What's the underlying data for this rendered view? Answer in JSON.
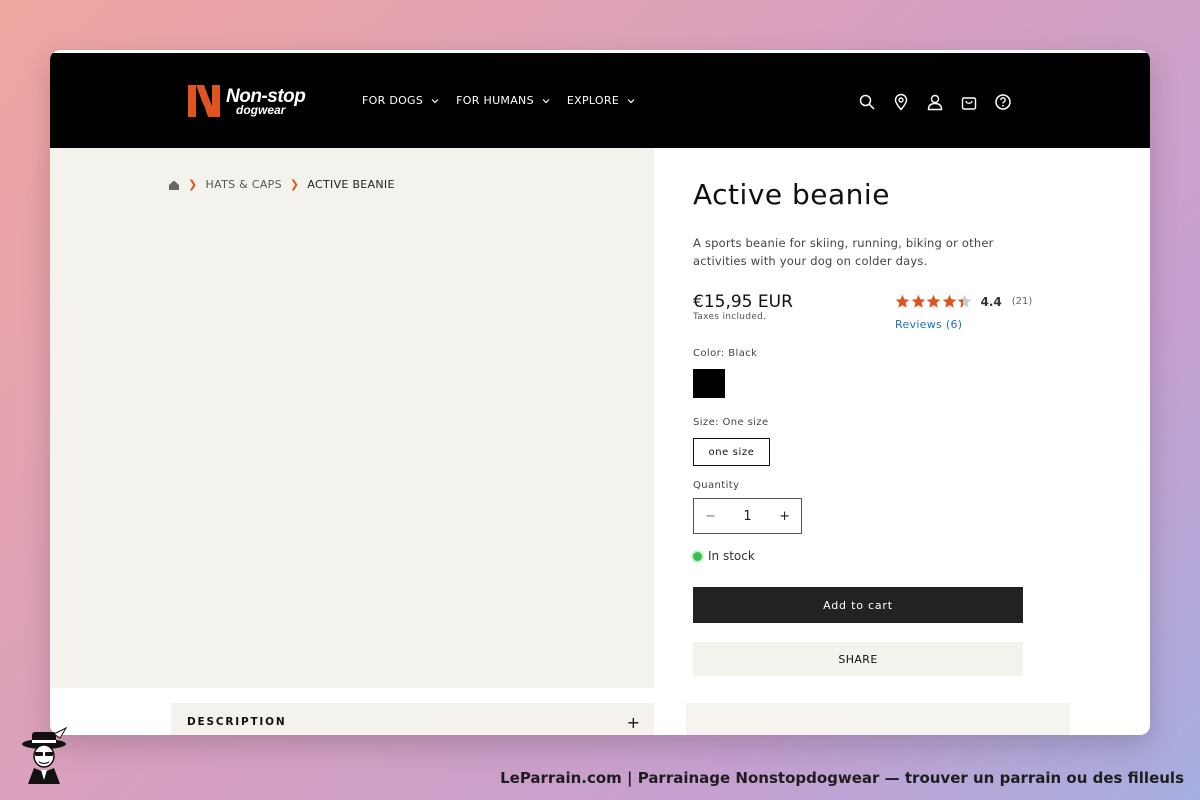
{
  "header": {
    "logo_main": "Non-stop",
    "logo_sub": "dogwear",
    "nav": [
      {
        "label": "FOR DOGS"
      },
      {
        "label": "FOR HUMANS"
      },
      {
        "label": "EXPLORE"
      }
    ]
  },
  "breadcrumb": {
    "items": [
      "HATS & CAPS",
      "ACTIVE BEANIE"
    ]
  },
  "product": {
    "title": "Active beanie",
    "description": "A sports beanie for skiing, running, biking or other activities with your dog on colder days.",
    "price": "€15,95 EUR",
    "tax_note": "Taxes included.",
    "rating": {
      "value": 4.4,
      "value_text": "4.4",
      "count_text": "(21)",
      "reviews_link": "Reviews (6)",
      "star_color": "#e0541f"
    },
    "color_label": "Color: Black",
    "color_swatch": "#000000",
    "size_label": "Size: One size",
    "size_option": "one size",
    "quantity_label": "Quantity",
    "quantity_minus": "−",
    "quantity_value": "1",
    "quantity_plus": "+",
    "stock_text": "In stock",
    "add_to_cart": "Add to cart",
    "share": "SHARE"
  },
  "description_section": {
    "label": "DESCRIPTION",
    "toggle": "+"
  },
  "footer": {
    "caption": "LeParrain.com | Parrainage Nonstopdogwear — trouver un parrain ou des filleuls"
  },
  "colors": {
    "accent": "#e0541f",
    "header_bg": "#000000",
    "panel_bg": "#f4f2ec",
    "button_dark": "#222222",
    "stock_green": "#3cbf4a",
    "link_blue": "#1e73b8"
  }
}
